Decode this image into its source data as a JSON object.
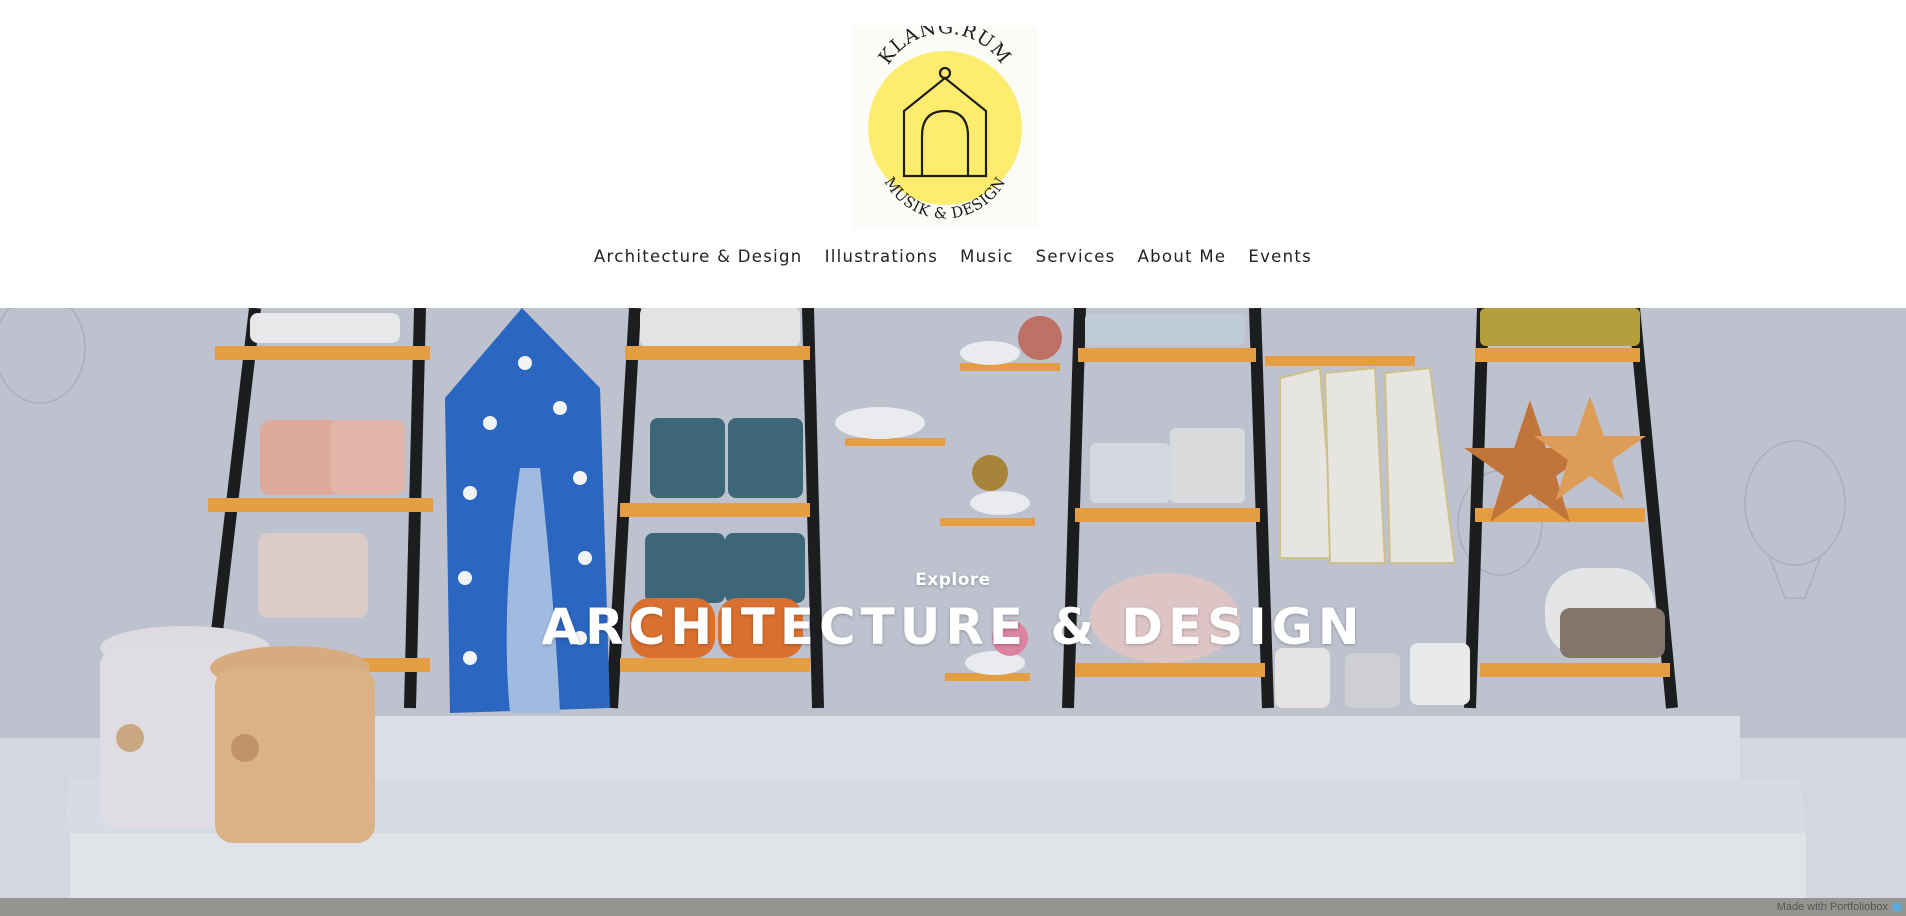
{
  "logo": {
    "top_text": "KLANG.RUM",
    "bottom_text": "MUSIK & DESIGN",
    "circle_color": "#fdec6e"
  },
  "nav": {
    "items": [
      {
        "label": "Architecture & Design"
      },
      {
        "label": "Illustrations"
      },
      {
        "label": "Music"
      },
      {
        "label": "Services"
      },
      {
        "label": "About Me"
      },
      {
        "label": "Events"
      }
    ]
  },
  "hero": {
    "kicker": "Explore",
    "title": "ARCHITECTURE & DESIGN"
  },
  "badge": {
    "label": "Made with Portfoliobox",
    "icon": "portfoliobox-icon"
  }
}
